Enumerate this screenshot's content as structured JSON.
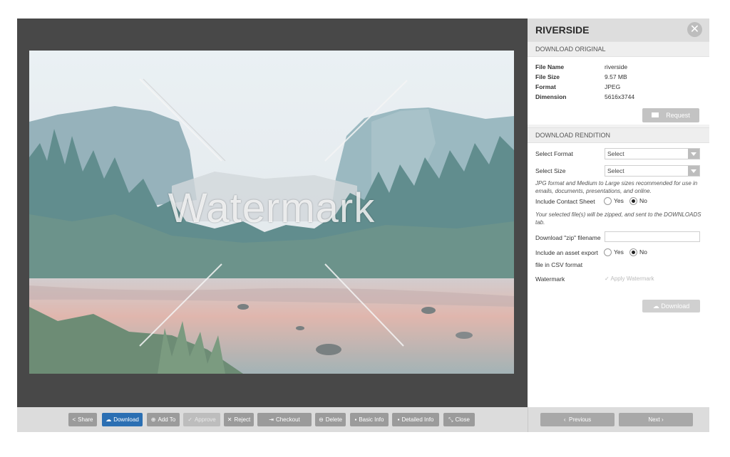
{
  "panel": {
    "title": "RIVERSIDE",
    "close_icon": "close-icon",
    "download_original_header": "DOWNLOAD ORIGINAL",
    "file_info": [
      {
        "label": "File Name",
        "value": "riverside"
      },
      {
        "label": "File Size",
        "value": "9.57 MB"
      },
      {
        "label": "Format",
        "value": "JPEG"
      },
      {
        "label": "Dimension",
        "value": "5616x3744"
      }
    ],
    "request_button": "Request",
    "download_rendition_header": "DOWNLOAD RENDITION",
    "select_format_label": "Select Format",
    "select_format_value": "Select",
    "select_size_label": "Select Size",
    "select_size_value": "Select",
    "size_note": "JPG format and Medium to Large sizes recommended for use in emails, documents, presentations, and online.",
    "contact_sheet_label": "Include Contact Sheet",
    "yes": "Yes",
    "no": "No",
    "zip_note": "Your selected file(s) will be zipped, and sent to the DOWNLOADS tab.",
    "zip_filename_label": "Download \"zip\" filename",
    "zip_filename_value": "",
    "asset_export_label_1": "Include an asset export",
    "asset_export_label_2": "file in CSV format",
    "watermark_label": "Watermark",
    "apply_watermark": "Apply Watermark",
    "download_button": "Download"
  },
  "preview": {
    "watermark_text": "Watermark"
  },
  "toolbar": {
    "share": "Share",
    "download": "Download",
    "add_to": "Add To",
    "approve": "Approve",
    "reject": "Reject",
    "checkout": "Checkout",
    "delete": "Delete",
    "basic_info": "Basic Info",
    "detailed_info": "Detailed Info",
    "close": "Close"
  },
  "nav": {
    "previous": "Previous",
    "next": "Next"
  },
  "colors": {
    "accent_blue": "#2b6fb3",
    "viewer_bg": "#484848"
  }
}
